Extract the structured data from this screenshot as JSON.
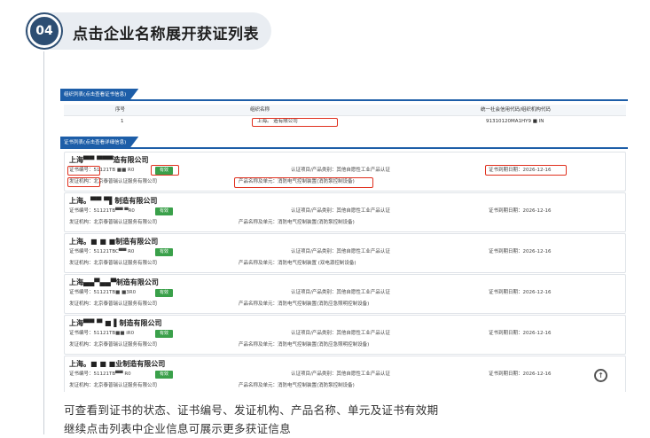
{
  "step": {
    "number": "04",
    "title": "点击企业名称展开获证列表"
  },
  "org_section": {
    "tab_label": "组织列表(点击查看证书信息)",
    "headers": [
      "序号",
      "组织名称",
      "统一社会信用代码/组织机构代码"
    ],
    "row": {
      "index": "1",
      "name": "上海。          造有限公司",
      "code": "91310120MA1HY9 ■  IN"
    }
  },
  "cert_section": {
    "tab_label": "证书列表(点击查看详细信息)"
  },
  "certificates": [
    {
      "company": "上海▀▀  ▀▀▀造有限公司",
      "cert_no": "证书编号：51121TB ■■   R0",
      "status": "有效",
      "issuer": "发证机构：北京泰普瑞认证服务有限公司",
      "scope": "认证项目/产品类别：其他自愿性工业产品认证",
      "product": "产品名称及单元：消防电气控制装置(消防泵控制设备)",
      "expiry": "证书到期日期：2026-12-16"
    },
    {
      "company": "上海。▀▀  ▀▌制造有限公司",
      "cert_no": "证书编号：51121TB▀▀  ▀R0",
      "status": "有效",
      "issuer": "发证机构：北京泰普瑞认证服务有限公司",
      "scope": "认证项目/产品类别：其他自愿性工业产品认证",
      "product": "产品名称及单元：消防电气控制装置(消防泵控制设备)",
      "expiry": "证书到期日期：2026-12-16"
    },
    {
      "company": "上海。■  ■  ■制造有限公司",
      "cert_no": "证书编号：51121TBC▀▀  R0",
      "status": "有效",
      "issuer": "发证机构：北京泰普瑞认证服务有限公司",
      "scope": "认证项目/产品类别：其他自愿性工业产品认证",
      "product": "产品名称及单元：消防电气控制装置  (双电源控制设备)",
      "expiry": "证书到期日期：2026-12-16"
    },
    {
      "company": "上海▄▄▀▄▄▀制造有限公司",
      "cert_no": "证书编号：51121TB■  ■3R0",
      "status": "有效",
      "issuer": "发证机构：北京泰普瑞认证服务有限公司",
      "scope": "认证项目/产品类别：其他自愿性工业产品认证",
      "product": "产品名称及单元：消防电气控制装置(消防应急照明控制设备)",
      "expiry": "证书到期日期：2026-12-16"
    },
    {
      "company": "上海▀▀  ▀  ■  ▌制造有限公司",
      "cert_no": "证书编号：51121TB■■   iR0",
      "status": "有效",
      "issuer": "发证机构：北京泰普瑞认证服务有限公司",
      "scope": "认证项目/产品类别：其他自愿性工业产品认证",
      "product": "产品名称及单元：消防电气控制装置(消防应急照明控制设备)",
      "expiry": "证书到期日期：2026-12-16"
    },
    {
      "company": "上海。■  ■  ■业制造有限公司",
      "cert_no": "证书编号：51121TB▀▀  R0",
      "status": "有效",
      "issuer": "发证机构：北京泰普瑞认证服务有限公司",
      "scope": "认证项目/产品类别：其他自愿性工业产品认证",
      "product": "产品名称及单元：消防电气控制装置(消防泵控制设备)",
      "expiry": "证书到期日期：2026-12-16"
    }
  ],
  "scroll_top_icon": "arrow-up-circle-icon",
  "captions": [
    "可查看到证书的状态、证书编号、发证机构、产品名称、单元及证书有效期",
    "继续点击列表中企业信息可展示更多获证信息"
  ],
  "colors": {
    "step_circle": "#2d4e73",
    "section_tab": "#1d5ea8",
    "status_badge": "#3aa04a",
    "highlight": "#e0301e"
  }
}
